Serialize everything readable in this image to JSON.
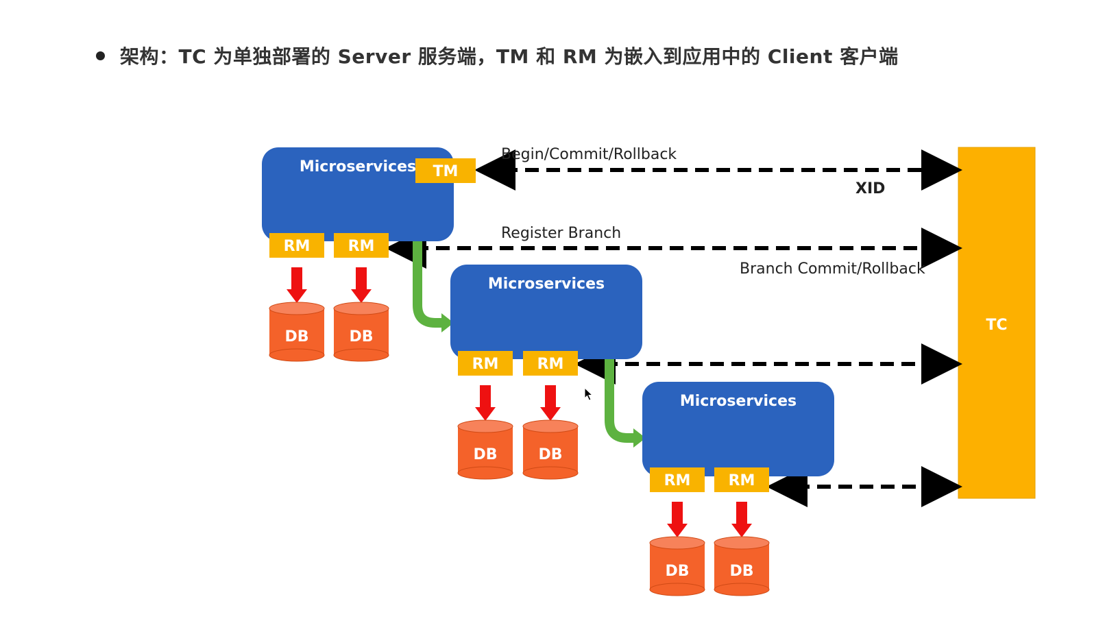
{
  "header": {
    "bullet_text": "架构：TC 为单独部署的 Server 服务端，TM 和 RM 为嵌入到应用中的 Client 客户端"
  },
  "diagram": {
    "tc_label": "TC",
    "tm_label": "TM",
    "services": [
      {
        "label": "Microservices",
        "rms": [
          "RM",
          "RM"
        ],
        "dbs": [
          "DB",
          "DB"
        ]
      },
      {
        "label": "Microservices",
        "rms": [
          "RM",
          "RM"
        ],
        "dbs": [
          "DB",
          "DB"
        ]
      },
      {
        "label": "Microservices",
        "rms": [
          "RM",
          "RM"
        ],
        "dbs": [
          "DB",
          "DB"
        ]
      }
    ],
    "labels": {
      "begin_commit_rollback": "Begin/Commit/Rollback",
      "xid": "XID",
      "register_branch": "Register Branch",
      "branch_commit_rollback": "Branch Commit/Rollback"
    }
  },
  "colors": {
    "service_blue": "#2B63BE",
    "tag_yellow": "#F9B300",
    "tc_yellow": "#FDB000",
    "db_orange": "#F4622A",
    "arrow_red": "#EE1111",
    "flow_green": "#5DB240",
    "dash_black": "#000000"
  }
}
